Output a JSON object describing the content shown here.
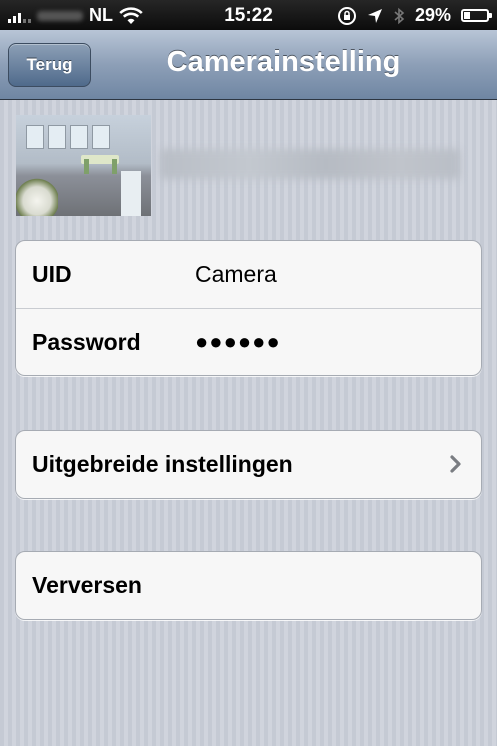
{
  "status_bar": {
    "carrier": "NL",
    "time": "15:22",
    "battery": "29%",
    "battery_level": 0.29
  },
  "nav": {
    "back_label": "Terug",
    "title": "Camerainstelling"
  },
  "camera": {
    "thumbnail_icon": "camera-thumbnail-image"
  },
  "credentials": {
    "uid_label": "UID",
    "uid_value": "Camera",
    "password_label": "Password",
    "password_value": "●●●●●●"
  },
  "advanced": {
    "label": "Uitgebreide instellingen"
  },
  "refresh": {
    "label": "Verversen"
  },
  "colors": {
    "nav_bar": "#8d9fb7",
    "background": "#c9ced8",
    "cell_background": "#f7f7f7"
  }
}
